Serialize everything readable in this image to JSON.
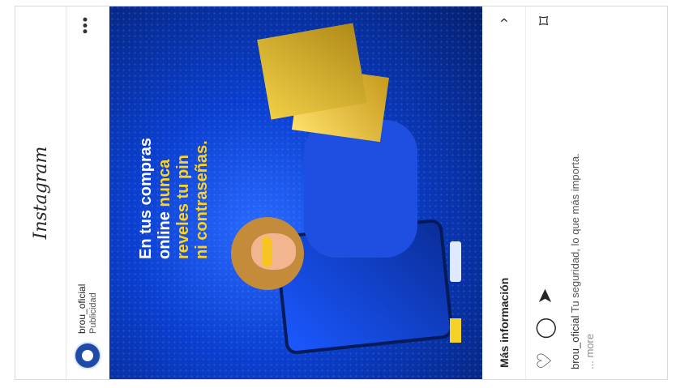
{
  "app": {
    "title": "Instagram"
  },
  "post": {
    "username": "brou_oficial",
    "sponsored_label": "Publicidad",
    "more_icon": "more-horizontal-icon"
  },
  "ad": {
    "headline_line1": "En tus compras",
    "headline_line2a": "online ",
    "headline_line2b": "nunca",
    "headline_line3": "reveles tu pin",
    "headline_line4": "ni contraseñas."
  },
  "cta": {
    "label": "Más información"
  },
  "actions": {
    "like_icon": "heart-icon",
    "comment_icon": "comment-icon",
    "share_icon": "send-icon",
    "save_icon": "bookmark-icon"
  },
  "caption": {
    "user": "brou_oficial",
    "text": " Tu seguridad, lo que más importa.",
    "more": "... more"
  }
}
